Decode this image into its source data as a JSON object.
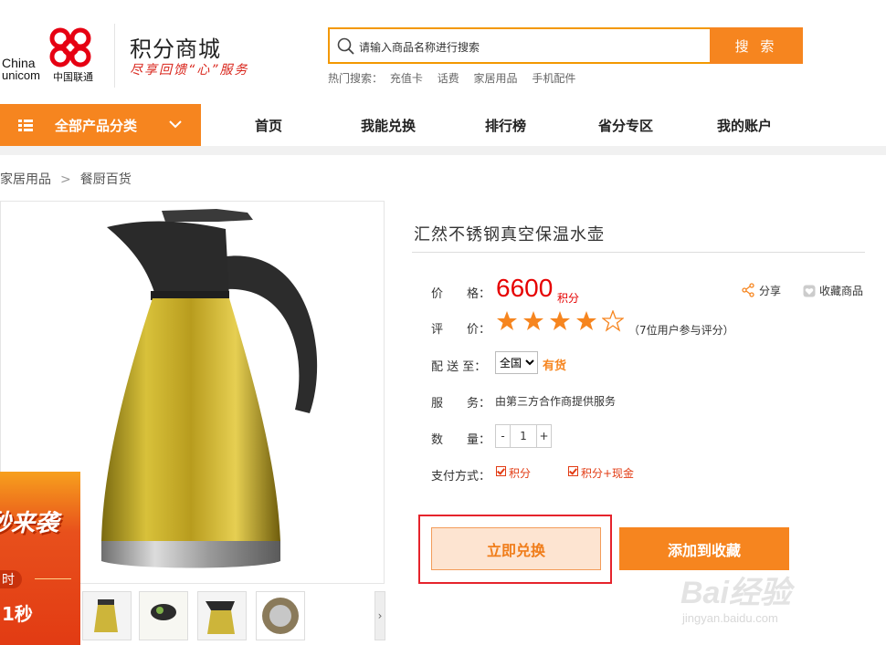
{
  "header": {
    "logo_line1": "China",
    "logo_line2": "unicom",
    "logo_cn": "中国联通",
    "site_title": "积分商城",
    "slogan": "尽享回馈“心”服务",
    "search_placeholder": "请输入商品名称进行搜索",
    "search_button": "搜 索",
    "hot_label": "热门搜索：",
    "hot_items": [
      "充值卡",
      "话费",
      "家居用品",
      "手机配件"
    ]
  },
  "nav": {
    "all_categories": "全部产品分类",
    "items": [
      "首页",
      "我能兑换",
      "排行榜",
      "省分专区",
      "我的账户"
    ]
  },
  "breadcrumb": [
    "家居用品",
    "餐厨百货"
  ],
  "promo": {
    "headline": "秒来袭",
    "timer_label": "时",
    "countdown": "1秒"
  },
  "product": {
    "title": "汇然不锈钢真空保温水壶",
    "price_label": "价　　格：",
    "price": "6600",
    "price_unit": "积分",
    "share": "分享",
    "favorite": "收藏商品",
    "rating_label": "评　　价：",
    "rating": 4,
    "rating_max": 5,
    "rating_count": "（7位用户参与评分）",
    "delivery_label": "配 送 至：",
    "delivery_region": "全国",
    "stock": "有货",
    "service_label": "服　　务：",
    "service": "由第三方合作商提供服务",
    "quantity_label": "数　　量：",
    "quantity": "1",
    "qty_minus": "-",
    "qty_plus": "+",
    "payment_label": "支付方式：",
    "payment_options": [
      "积分",
      "积分+现金"
    ],
    "exchange_button": "立即兑换",
    "add_favorite_button": "添加到收藏"
  },
  "watermark": {
    "brand": "Bai经验",
    "url": "jingyan.baidu.com"
  },
  "colors": {
    "accent_orange": "#f6851f",
    "price_red": "#e60000",
    "highlight_red": "#e5232c",
    "gold": "#c9a825"
  }
}
